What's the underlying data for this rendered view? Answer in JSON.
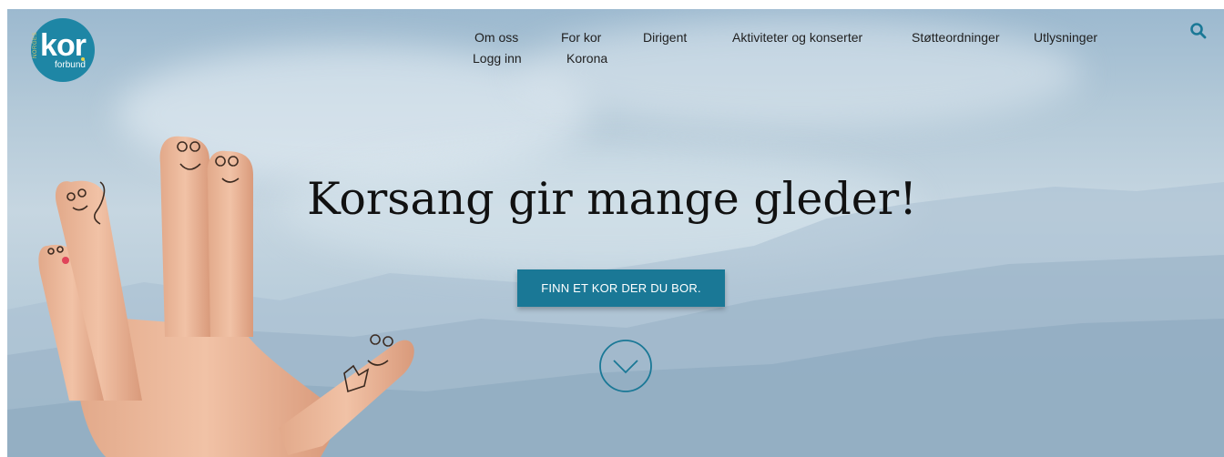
{
  "logo": {
    "main_text": "kor",
    "sub_text": "forbund",
    "top_text": "NORGES"
  },
  "nav": {
    "items": [
      {
        "label": "Om oss"
      },
      {
        "label": "For kor"
      },
      {
        "label": "Dirigent"
      },
      {
        "label": "Aktiviteter og konserter"
      },
      {
        "label": "Støtteordninger"
      },
      {
        "label": "Utlysninger"
      },
      {
        "label": "Logg inn"
      },
      {
        "label": "Korona"
      }
    ],
    "search_icon": "search-icon"
  },
  "hero": {
    "headline": "Korsang gir mange gleder!",
    "cta_label": "FINN ET KOR DER DU BOR.",
    "scroll_icon": "chevron-down-circle-icon",
    "image": "hand-with-finger-faces"
  },
  "colors": {
    "brand": "#1e86a5",
    "cta": "#1a7896",
    "logo_accent": "#e3d34e"
  }
}
